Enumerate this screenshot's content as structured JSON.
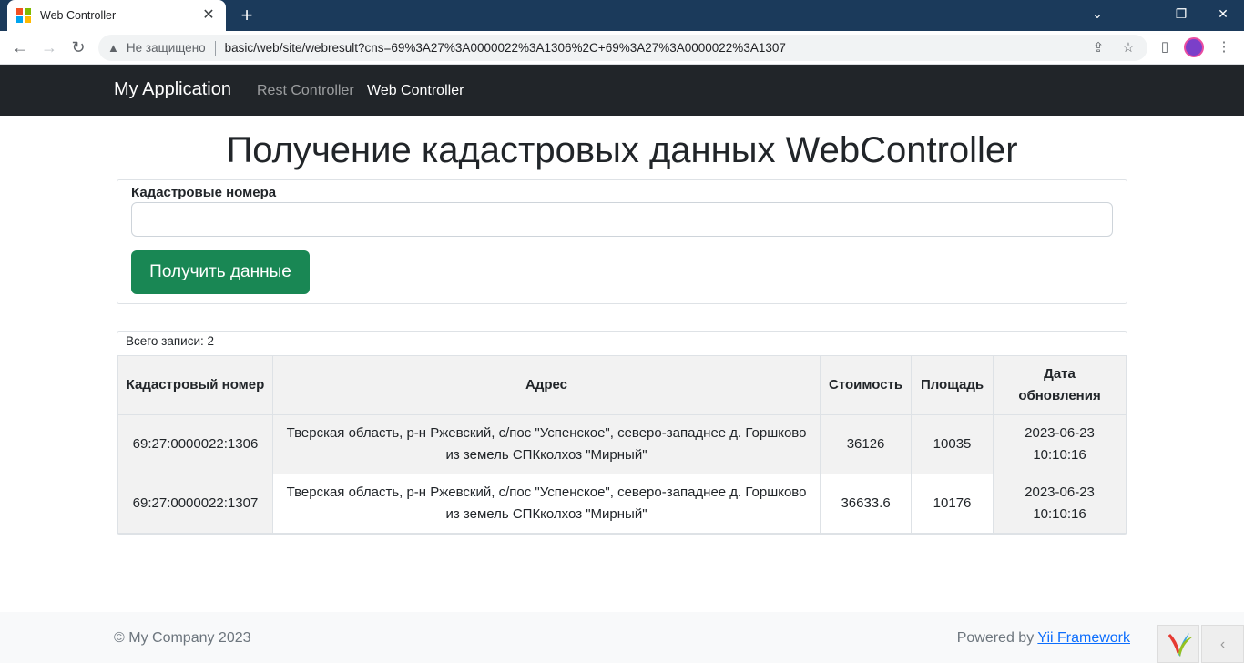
{
  "browser": {
    "tab_title": "Web Controller",
    "tab_close": "✕",
    "new_tab": "+",
    "security_text": "Не защищено",
    "url": "basic/web/site/webresult?cns=69%3A27%3A0000022%3A1306%2C+69%3A27%3A0000022%3A1307",
    "favicon_colors": [
      "#f25022",
      "#7fba00",
      "#00a4ef",
      "#ffb900"
    ]
  },
  "navbar": {
    "brand": "My Application",
    "links": [
      {
        "label": "Rest Controller",
        "active": false
      },
      {
        "label": "Web Controller",
        "active": true
      }
    ]
  },
  "page": {
    "title": "Получение кадастровых данных WebController"
  },
  "form": {
    "label": "Кадастровые номера",
    "input_value": "",
    "submit_label": "Получить данные"
  },
  "grid": {
    "summary": "Всего записи: 2",
    "columns": [
      "Кадастровый номер",
      "Адрес",
      "Стоимость",
      "Площадь",
      "Дата обновления"
    ],
    "rows": [
      {
        "number": "69:27:0000022:1306",
        "address": "Тверская область, р-н Ржевский, с/пос \"Успенское\", северо-западнее д. Горшково из земель СПКколхоз \"Мирный\"",
        "cost": "36126",
        "area": "10035",
        "updated": "2023-06-23 10:10:16"
      },
      {
        "number": "69:27:0000022:1307",
        "address": "Тверская область, р-н Ржевский, с/пос \"Успенское\", северо-западнее д. Горшково из земель СПКколхоз \"Мирный\"",
        "cost": "36633.6",
        "area": "10176",
        "updated": "2023-06-23 10:10:16"
      }
    ]
  },
  "footer": {
    "copyright": "© My Company 2023",
    "powered_prefix": "Powered by ",
    "powered_link": "Yii Framework",
    "toggle": "‹"
  },
  "colors": {
    "navbar_bg": "#212529",
    "button_bg": "#198754",
    "link": "#0d6efd"
  }
}
